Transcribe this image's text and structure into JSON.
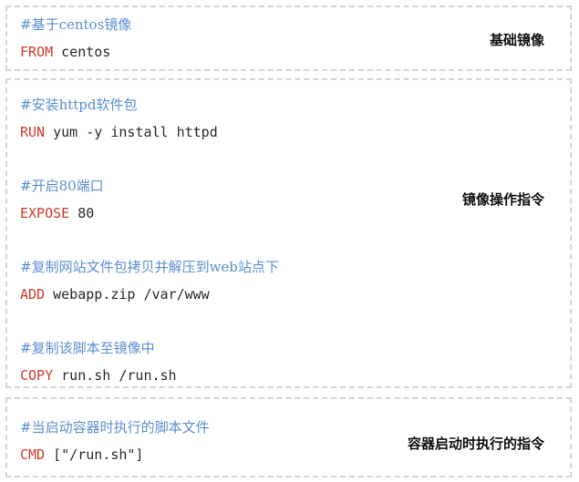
{
  "sections": [
    {
      "label": "基础镜像",
      "lines": [
        {
          "comment": "#基于centos镜像"
        },
        {
          "keyword": "FROM",
          "args": " centos"
        }
      ]
    },
    {
      "label": "镜像操作指令",
      "lines": [
        {
          "comment": "#安装httpd软件包"
        },
        {
          "keyword": "RUN",
          "args": " yum -y install httpd"
        },
        {
          "comment": "#开启80端口"
        },
        {
          "keyword": "EXPOSE",
          "args": " 80"
        },
        {
          "comment": "#复制网站文件包拷贝并解压到web站点下"
        },
        {
          "keyword": "ADD",
          "args": " webapp.zip /var/www"
        },
        {
          "comment": "#复制该脚本至镜像中"
        },
        {
          "keyword": "COPY",
          "args": " run.sh /run.sh"
        }
      ]
    },
    {
      "label": "容器启动时执行的指令",
      "lines": [
        {
          "comment": "#当启动容器时执行的脚本文件"
        },
        {
          "keyword": "CMD",
          "args": " [\"/run.sh\"]"
        }
      ]
    }
  ]
}
